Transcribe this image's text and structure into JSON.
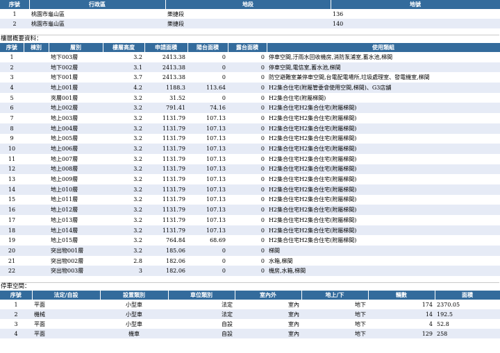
{
  "land": {
    "headers": [
      "序號",
      "行政區",
      "地段",
      "地號"
    ],
    "rows": [
      [
        "1",
        "桃園市龜山區",
        "樂捷段",
        "136"
      ],
      [
        "2",
        "桃園市龜山區",
        "樂捷段",
        "140"
      ]
    ]
  },
  "floors": {
    "title": "樓層概要資料：",
    "headers": [
      "序號",
      "棟別",
      "層別",
      "樓層高度",
      "申請面積",
      "陽台面積",
      "露台面積",
      "使用類組"
    ],
    "rows": [
      [
        "1",
        "",
        "地下003層",
        "3.2",
        "2413.38",
        "0",
        "0",
        "停車空間,汙雨水回收機房,消防泵浦室,蓄水池,梯間"
      ],
      [
        "2",
        "",
        "地下002層",
        "3.1",
        "2413.38",
        "0",
        "0",
        "停車空間,電信室,蓄水池,梯間"
      ],
      [
        "3",
        "",
        "地下001層",
        "3.7",
        "2413.38",
        "0",
        "0",
        "防空避難室兼停車空間,台電配電場所,垃圾處理室、發電機室,梯間"
      ],
      [
        "4",
        "",
        "地上001層",
        "4.2",
        "1188.3",
        "113.64",
        "0",
        "H2集合住宅(附屬管委會使用空間,梯間)、G3店舖"
      ],
      [
        "5",
        "",
        "夾層001層",
        "3.2",
        "31.52",
        "0",
        "0",
        "H2集合住宅(附屬梯間)"
      ],
      [
        "6",
        "",
        "地上002層",
        "3.2",
        "791.41",
        "74.16",
        "0",
        "H2集合住宅H2集合住宅(附屬梯間)"
      ],
      [
        "7",
        "",
        "地上003層",
        "3.2",
        "1131.79",
        "107.13",
        "0",
        "H2集合住宅H2集合住宅(附屬梯間)"
      ],
      [
        "8",
        "",
        "地上004層",
        "3.2",
        "1131.79",
        "107.13",
        "0",
        "H2集合住宅H2集合住宅(附屬梯間)"
      ],
      [
        "9",
        "",
        "地上005層",
        "3.2",
        "1131.79",
        "107.13",
        "0",
        "H2集合住宅H2集合住宅(附屬梯間)"
      ],
      [
        "10",
        "",
        "地上006層",
        "3.2",
        "1131.79",
        "107.13",
        "0",
        "H2集合住宅H2集合住宅(附屬梯間)"
      ],
      [
        "11",
        "",
        "地上007層",
        "3.2",
        "1131.79",
        "107.13",
        "0",
        "H2集合住宅H2集合住宅(附屬梯間)"
      ],
      [
        "12",
        "",
        "地上008層",
        "3.2",
        "1131.79",
        "107.13",
        "0",
        "H2集合住宅H2集合住宅(附屬梯間)"
      ],
      [
        "13",
        "",
        "地上009層",
        "3.2",
        "1131.79",
        "107.13",
        "0",
        "H2集合住宅H2集合住宅(附屬梯間)"
      ],
      [
        "14",
        "",
        "地上010層",
        "3.2",
        "1131.79",
        "107.13",
        "0",
        "H2集合住宅H2集合住宅(附屬梯間)"
      ],
      [
        "15",
        "",
        "地上011層",
        "3.2",
        "1131.79",
        "107.13",
        "0",
        "H2集合住宅H2集合住宅(附屬梯間)"
      ],
      [
        "16",
        "",
        "地上012層",
        "3.2",
        "1131.79",
        "107.13",
        "0",
        "H2集合住宅H2集合住宅(附屬梯間)"
      ],
      [
        "17",
        "",
        "地上013層",
        "3.2",
        "1131.79",
        "107.13",
        "0",
        "H2集合住宅H2集合住宅(附屬梯間)"
      ],
      [
        "18",
        "",
        "地上014層",
        "3.2",
        "1131.79",
        "107.13",
        "0",
        "H2集合住宅H2集合住宅(附屬梯間)"
      ],
      [
        "19",
        "",
        "地上015層",
        "3.2",
        "764.84",
        "68.69",
        "0",
        "H2集合住宅H2集合住宅(附屬梯間)"
      ],
      [
        "20",
        "",
        "突出物001層",
        "3.2",
        "185.06",
        "0",
        "0",
        "梯間"
      ],
      [
        "21",
        "",
        "突出物002層",
        "2.8",
        "182.06",
        "0",
        "0",
        "水箱,梯間"
      ],
      [
        "22",
        "",
        "突出物003層",
        "3",
        "182.06",
        "0",
        "0",
        "機房,水箱,梯間"
      ]
    ]
  },
  "parking": {
    "title": "停車空間：",
    "headers": [
      "序號",
      "法定/自設",
      "設置類別",
      "車位類別",
      "室內外",
      "地上/下",
      "輛數",
      "面積"
    ],
    "rows": [
      [
        "1",
        "平面",
        "小型車",
        "法定",
        "室內",
        "地下",
        "174",
        "2370.05"
      ],
      [
        "2",
        "機械",
        "小型車",
        "法定",
        "室內",
        "地下",
        "14",
        "192.5"
      ],
      [
        "3",
        "平面",
        "小型車",
        "自設",
        "室內",
        "地下",
        "4",
        "52.8"
      ],
      [
        "4",
        "平面",
        "機車",
        "自設",
        "室內",
        "地下",
        "129",
        "258"
      ]
    ]
  }
}
